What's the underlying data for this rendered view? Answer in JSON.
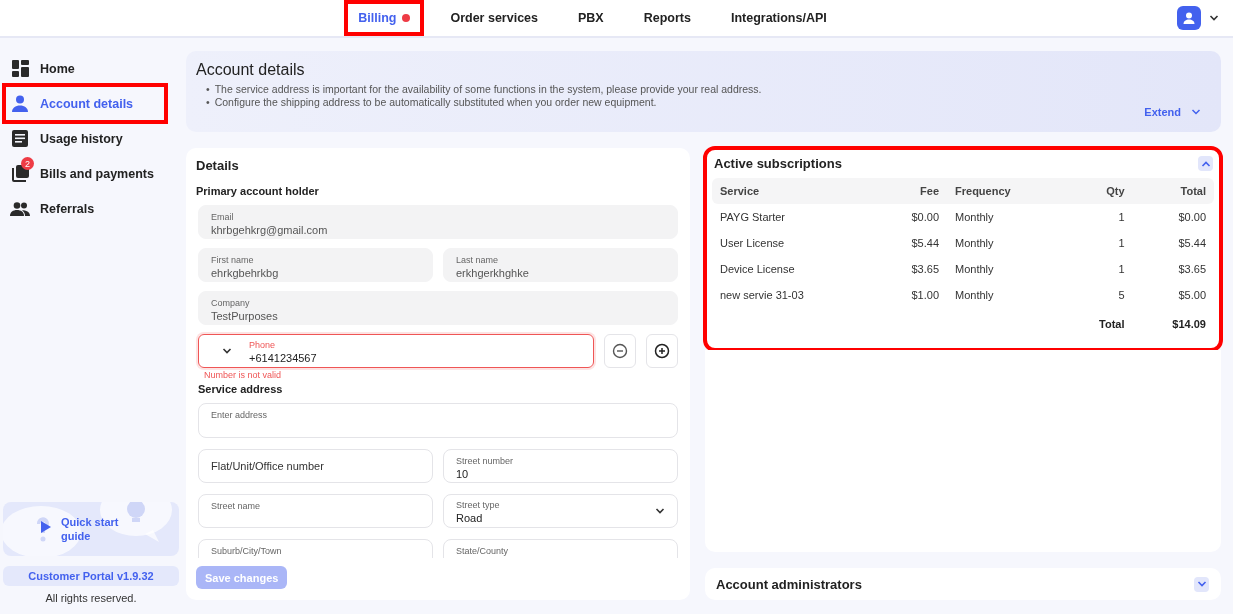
{
  "top_nav": {
    "items": [
      {
        "label": "Billing",
        "selected": true,
        "alert": true,
        "highlighted": true
      },
      {
        "label": "Order services",
        "selected": false,
        "alert": false
      },
      {
        "label": "PBX",
        "selected": false,
        "alert": false
      },
      {
        "label": "Reports",
        "selected": false,
        "alert": false
      },
      {
        "label": "Integrations/API",
        "selected": false,
        "alert": false
      }
    ]
  },
  "sidebar": {
    "items": [
      {
        "label": "Home",
        "selected": false
      },
      {
        "label": "Account details",
        "selected": true,
        "highlighted": true
      },
      {
        "label": "Usage history",
        "selected": false
      },
      {
        "label": "Bills and payments",
        "selected": false,
        "badge": "2"
      },
      {
        "label": "Referrals",
        "selected": false
      }
    ],
    "guide": "Quick start guide",
    "version": "Customer Portal v1.9.32",
    "footer": "All rights reserved."
  },
  "banner": {
    "title": "Account details",
    "bullet": "•",
    "notes": [
      "The service address is important for the availability of some functions in the system, please provide your real address.",
      "Configure the shipping address to be automatically substituted when you order new equipment."
    ],
    "extend": "Extend"
  },
  "details": {
    "title": "Details",
    "holder_heading": "Primary account holder",
    "holder_rows": [
      [
        {
          "kind": "text",
          "label": "Email",
          "value": "khrbgehkrg@gmail.com",
          "disabled": true
        }
      ],
      [
        {
          "kind": "text",
          "label": "First name",
          "value": "ehrkgbehrkbg",
          "disabled": true
        },
        {
          "kind": "text",
          "label": "Last name",
          "value": "erkhgerkhghke",
          "disabled": true
        }
      ],
      [
        {
          "kind": "text",
          "label": "Company",
          "value": "TestPurposes",
          "disabled": true
        }
      ]
    ],
    "phone": {
      "label": "Phone",
      "value": "+6141234567",
      "invalid": true,
      "error": "Number is not valid"
    },
    "address_heading": "Service address",
    "address_rows": [
      [
        {
          "kind": "text",
          "label": "Enter address",
          "disabled": false
        }
      ],
      [
        {
          "kind": "placeholder",
          "placeholder": "Flat/Unit/Office number",
          "disabled": false
        },
        {
          "kind": "text",
          "label": "Street number",
          "value": "10",
          "disabled": false
        }
      ],
      [
        {
          "kind": "text",
          "label": "Street name",
          "disabled": false
        },
        {
          "kind": "select",
          "label": "Street type",
          "value": "Road",
          "disabled": false
        }
      ],
      [
        {
          "kind": "text",
          "label": "Suburb/City/Town",
          "disabled": false
        },
        {
          "kind": "text",
          "label": "State/County",
          "disabled": false
        }
      ]
    ],
    "save_button": {
      "label": "Save changes",
      "disabled": true
    }
  },
  "subscriptions": {
    "title": "Active subscriptions",
    "expanded": true,
    "highlighted": true,
    "columns": [
      "Service",
      "Fee",
      "Frequency",
      "Qty",
      "Total"
    ],
    "rows": [
      [
        "PAYG Starter",
        "$0.00",
        "Monthly",
        "1",
        "$0.00"
      ],
      [
        "User License",
        "$5.44",
        "Monthly",
        "1",
        "$5.44"
      ],
      [
        "Device License",
        "$3.65",
        "Monthly",
        "1",
        "$3.65"
      ],
      [
        "new servie 31-03",
        "$1.00",
        "Monthly",
        "5",
        "$5.00"
      ]
    ],
    "total_label": "Total",
    "total_value": "$14.09"
  },
  "administrators": {
    "title": "Account administrators",
    "expanded": false
  }
}
